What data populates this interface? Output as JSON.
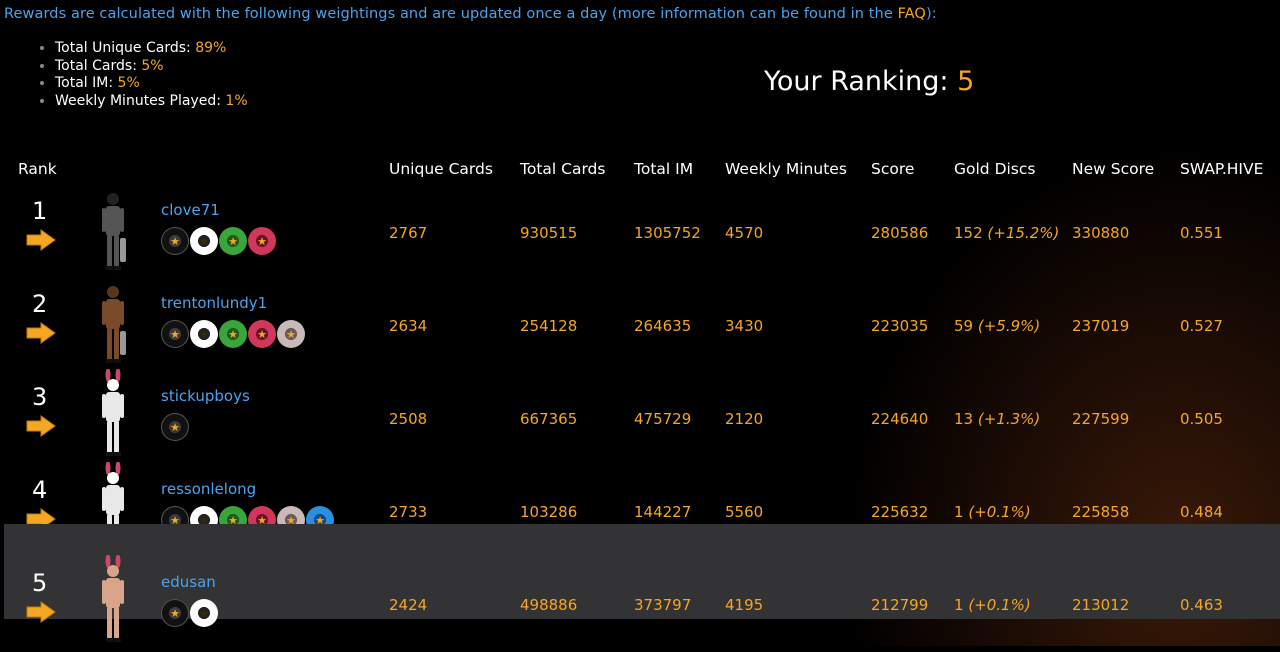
{
  "intro": {
    "text_before": "Rewards are calculated with the following weightings and are updated once a day (more information can be found in the ",
    "faq_link": "FAQ",
    "text_after": "):"
  },
  "weights": [
    {
      "label": "Total Unique Cards:",
      "value": "89%"
    },
    {
      "label": "Total Cards:",
      "value": "5%"
    },
    {
      "label": "Total IM:",
      "value": "5%"
    },
    {
      "label": "Weekly Minutes Played:",
      "value": "1%"
    }
  ],
  "your_ranking": {
    "label": "Your Ranking:",
    "value": "5"
  },
  "columns": [
    "Rank",
    "Unique Cards",
    "Total Cards",
    "Total IM",
    "Weekly Minutes",
    "Score",
    "Gold Discs",
    "New Score",
    "SWAP.HIVE"
  ],
  "rows": [
    {
      "rank": "1",
      "user": "clove71",
      "unique": "2767",
      "total": "930515",
      "im": "1305752",
      "minutes": "4570",
      "score": "280586",
      "gold": "152",
      "gold_pct": "(+15.2%)",
      "new_score": "330880",
      "swap": "0.551",
      "discs": [
        "black",
        "white",
        "green",
        "red"
      ],
      "highlight": false
    },
    {
      "rank": "2",
      "user": "trentonlundy1",
      "unique": "2634",
      "total": "254128",
      "im": "264635",
      "minutes": "3430",
      "score": "223035",
      "gold": "59",
      "gold_pct": "(+5.9%)",
      "new_score": "237019",
      "swap": "0.527",
      "discs": [
        "black",
        "white",
        "green",
        "red",
        "grey"
      ],
      "highlight": false
    },
    {
      "rank": "3",
      "user": "stickupboys",
      "unique": "2508",
      "total": "667365",
      "im": "475729",
      "minutes": "2120",
      "score": "224640",
      "gold": "13",
      "gold_pct": "(+1.3%)",
      "new_score": "227599",
      "swap": "0.505",
      "discs": [
        "black"
      ],
      "highlight": false
    },
    {
      "rank": "4",
      "user": "ressonlelong",
      "unique": "2733",
      "total": "103286",
      "im": "144227",
      "minutes": "5560",
      "score": "225632",
      "gold": "1",
      "gold_pct": "(+0.1%)",
      "new_score": "225858",
      "swap": "0.484",
      "discs": [
        "black",
        "white",
        "green",
        "red",
        "grey",
        "blue"
      ],
      "highlight": false
    },
    {
      "rank": "5",
      "user": "edusan",
      "unique": "2424",
      "total": "498886",
      "im": "373797",
      "minutes": "4195",
      "score": "212799",
      "gold": "1",
      "gold_pct": "(+0.1%)",
      "new_score": "213012",
      "swap": "0.463",
      "discs": [
        "black",
        "white"
      ],
      "highlight": true
    }
  ],
  "colors": {
    "accent": "#f5a623",
    "link": "#4aa3ee",
    "highlight_row": "#333335"
  }
}
